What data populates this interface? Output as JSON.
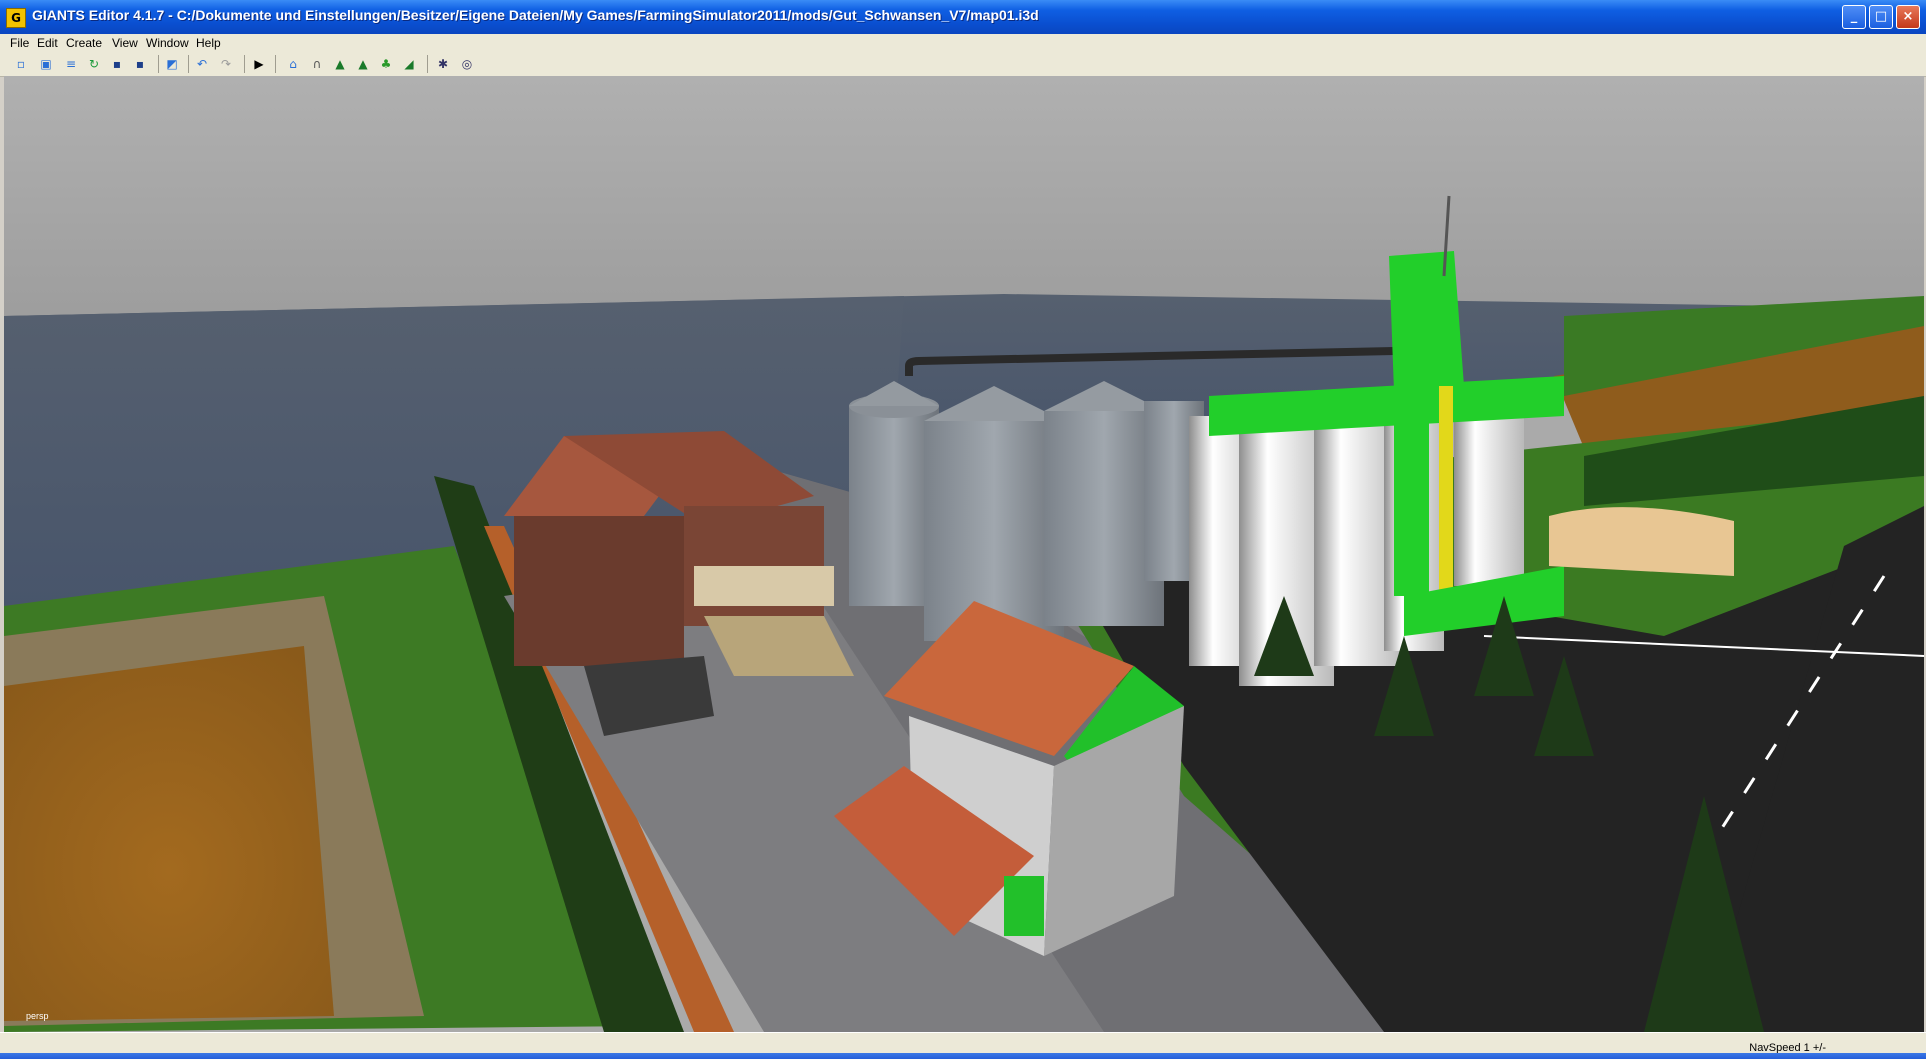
{
  "window": {
    "title": "GIANTS Editor 4.1.7 - C:/Dokumente und Einstellungen/Besitzer/Eigene Dateien/My Games/FarmingSimulator2011/mods/Gut_Schwansen_V7/map01.i3d",
    "icon": "giants-app-icon",
    "minimize": "_",
    "maximize": "□",
    "close": "×"
  },
  "menu": {
    "items": [
      {
        "label": "File"
      },
      {
        "label": "Edit"
      },
      {
        "label": "Create"
      },
      {
        "label": "View"
      },
      {
        "label": "Window"
      },
      {
        "label": "Help"
      }
    ]
  },
  "toolbar": {
    "buttons": [
      {
        "icon": "new-icon",
        "glyph": "▫",
        "color": "#2a6fd6"
      },
      {
        "icon": "open-icon",
        "glyph": "▣",
        "color": "#2a6fd6"
      },
      {
        "icon": "import-icon",
        "glyph": "≡",
        "color": "#2a6fd6"
      },
      {
        "icon": "refresh-icon",
        "glyph": "↻",
        "color": "#1a9a3a"
      },
      {
        "icon": "save-icon",
        "glyph": "▪",
        "color": "#1d3f8a"
      },
      {
        "icon": "save-all-icon",
        "glyph": "▪",
        "color": "#1d3f8a"
      },
      {
        "icon": "export-icon",
        "glyph": "◩",
        "color": "#2a6fd6"
      },
      {
        "icon": "undo-icon",
        "glyph": "↶",
        "color": "#2a6fd6"
      },
      {
        "icon": "redo-icon",
        "glyph": "↷",
        "color": "#9a9a9a"
      },
      {
        "icon": "play-icon",
        "glyph": "▶",
        "color": "#000000"
      },
      {
        "icon": "select-icon",
        "glyph": "⌂",
        "color": "#2a6fd6"
      },
      {
        "icon": "move-icon",
        "glyph": "∩",
        "color": "#555555"
      },
      {
        "icon": "terrain-sculpt-icon",
        "glyph": "▲",
        "color": "#1a7a2a"
      },
      {
        "icon": "terrain-paint-icon",
        "glyph": "▲",
        "color": "#1a7a2a"
      },
      {
        "icon": "foliage-icon",
        "glyph": "♣",
        "color": "#2a9a2a"
      },
      {
        "icon": "terrain-edit-icon",
        "glyph": "◢",
        "color": "#1a7a2a"
      },
      {
        "icon": "grid-icon",
        "glyph": "✱",
        "color": "#333366"
      },
      {
        "icon": "snap-icon",
        "glyph": "◎",
        "color": "#333366"
      }
    ]
  },
  "viewport": {
    "camera_label": "persp",
    "colors": {
      "sky": "#a5a5a5",
      "sea": "#4e5a6c",
      "grass": "#3c7a22",
      "field": "#9a6420",
      "asphalt": "#242424",
      "gravel": "#7c7c7c",
      "silo_green": "#21d12a",
      "roof_red": "#b45a44"
    }
  },
  "status": {
    "navspeed": "NavSpeed 1 +/-"
  }
}
